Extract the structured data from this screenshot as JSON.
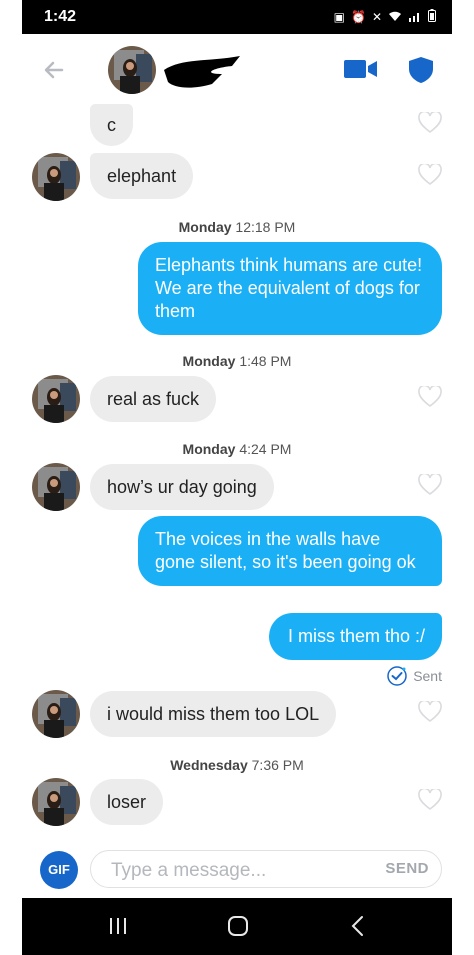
{
  "status_bar": {
    "time": "1:42"
  },
  "header": {
    "back_icon": "arrow-left-icon",
    "video_icon": "video-camera-icon",
    "safety_icon": "shield-icon",
    "accent": "#1667c9"
  },
  "messages": {
    "m1": "c",
    "m2": "elephant",
    "ts1": {
      "day": "Monday",
      "time": "12:18 PM"
    },
    "m3": "Elephants think humans are cute! We are the equivalent of dogs for them",
    "ts2": {
      "day": "Monday",
      "time": "1:48 PM"
    },
    "m4": "real as fuck",
    "ts3": {
      "day": "Monday",
      "time": "4:24 PM"
    },
    "m5": "how’s ur day going",
    "m6": "The voices in the walls have gone silent, so it's been going ok",
    "m7": "I miss them tho :/",
    "sent_status": "Sent",
    "m8": "i would miss them too LOL",
    "ts4": {
      "day": "Wednesday",
      "time": "7:36 PM"
    },
    "m9": "loser"
  },
  "colors": {
    "outgoing_bubble": "#1bb0f5",
    "incoming_bubble": "#ececec"
  },
  "composer": {
    "gif_label": "GIF",
    "placeholder": "Type a message...",
    "send_label": "SEND"
  },
  "nav": {
    "recents_icon": "recents-icon",
    "home_icon": "home-icon",
    "back_icon": "back-chevron-icon"
  }
}
